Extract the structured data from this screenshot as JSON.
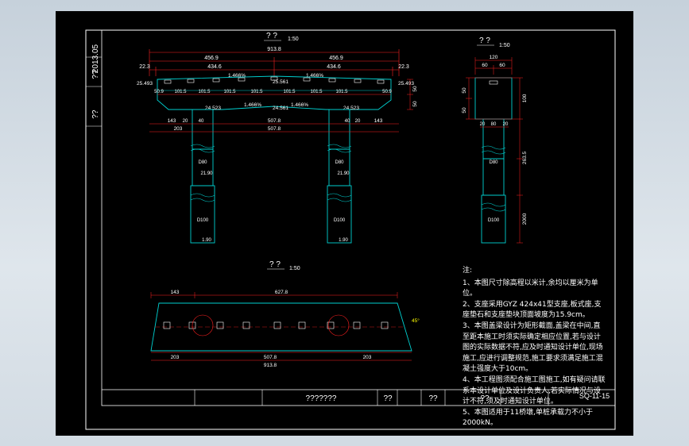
{
  "drawing": {
    "year_tag": "2013.05",
    "side_tag_a": "??",
    "side_tag_b": "??",
    "title_block": {
      "name": "???????",
      "cell_a": "??",
      "cell_b": "??",
      "cell_c": "??",
      "drawing_no": "SQ-11-15"
    },
    "views": {
      "elevation": {
        "title": "? ?",
        "scale": "1:50"
      },
      "side": {
        "title": "? ?",
        "scale": "1:50"
      },
      "plan": {
        "title": "? ?",
        "scale": "1:50"
      }
    },
    "elevation_dims": {
      "total": "913.8",
      "half_left": "456.9",
      "half_right": "456.9",
      "inner_left": "434.6",
      "inner_right": "434.6",
      "edge_left": "22.3",
      "edge_right": "22.3",
      "cap_left": "25.493",
      "cap_right": "25.493",
      "slope_left": "1.466%",
      "slope_right": "1.466%",
      "center_elev": "25.561",
      "bottom_slope_left": "1.466%",
      "bottom_slope_right": "1.466%",
      "bottom_center": "24.561",
      "bottom_left": "24.523",
      "bottom_right": "24.523",
      "bearing_spacings": [
        "50.9",
        "101.5",
        "101.5",
        "101.5",
        "101.5",
        "101.5",
        "101.5",
        "101.5",
        "50.9"
      ],
      "overhang_left": "143",
      "overhang_right": "143",
      "col_width_left": "40",
      "col_width_right": "40",
      "col_width_left2": "20",
      "col_width_right2": "20",
      "pier_spacing_top": "507.8",
      "half_span_left": "203",
      "pier_spacing": "507.8",
      "beam_h1": "50",
      "beam_h2": "50",
      "col_dia_top_left": "D80",
      "col_dia_top_right": "D80",
      "col_level_left": "21.90",
      "col_level_right": "21.90",
      "pile_dia_left": "D100",
      "pile_dia_right": "D100",
      "pile_bot_left": "1.90",
      "pile_bot_right": "1.90"
    },
    "side_dims": {
      "width": "120",
      "left": "60",
      "right": "60",
      "h1": "50",
      "h2": "50",
      "h_right1": "100",
      "col_left": "20",
      "col_mid": "80",
      "col_right": "20",
      "col_dia": "D80",
      "pile_dia": "D100",
      "col_height": "263.5",
      "pile_height": "2000"
    },
    "plan_dims": {
      "left": "143",
      "top_span": "627.8",
      "bot_left": "203",
      "bot_mid": "507.8",
      "bot_right": "203",
      "total": "913.8",
      "skew": "45°"
    },
    "notes": {
      "heading": "注:",
      "items": [
        "1、本图尺寸除高程以米计,余均以厘米为单位。",
        "2、支座采用GYZ 424x41型支座,板式座,支座垫石和支座垫块顶面坡度为15.9cm。",
        "3、本图盖梁设计为矩形截面,盖梁在中间,直至距本施工时须实际确定相应位置,若与设计图的实际数据不符,应及时通知设计单位,现场施工,应进行调整规范,施工要求须满足施工混凝土强度大于10cm。",
        "4、本工程图须配合施工图施工,如有疑问请联系本设计单位及设计负责人,若实际情况与设计不符,须及时通知设计单位。",
        "5、本图适用于11桥墩,单桩承载力不小于2000kN。"
      ]
    }
  },
  "colors": {
    "background": "#000000",
    "frame": "#ffffff",
    "dimension": "#ff2020",
    "structure": "#00d0d0",
    "text": "#ffffff",
    "hatch_mark": "#ffff00"
  }
}
